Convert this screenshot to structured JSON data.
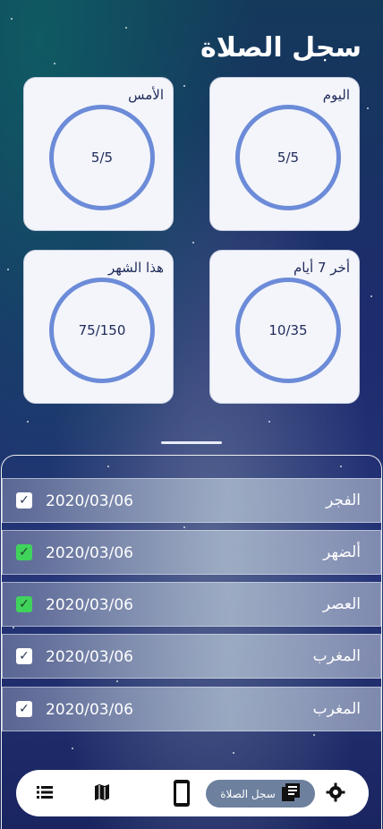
{
  "header": {
    "title": "سجل الصلاة"
  },
  "cards": [
    {
      "label": "اليوم",
      "value": "5/5"
    },
    {
      "label": "الأمس",
      "value": "5/5"
    },
    {
      "label": "أخر 7 أيام",
      "value": "10/35"
    },
    {
      "label": "هذا الشهر",
      "value": "75/150"
    }
  ],
  "prayers": [
    {
      "name": "الفجر",
      "date": "2020/03/06",
      "checked": true,
      "done": false
    },
    {
      "name": "ألضهر",
      "date": "2020/03/06",
      "checked": true,
      "done": true
    },
    {
      "name": "العصر",
      "date": "2020/03/06",
      "checked": true,
      "done": true
    },
    {
      "name": "المغرب",
      "date": "2020/03/06",
      "checked": true,
      "done": false
    },
    {
      "name": "المغرب",
      "date": "2020/03/06",
      "checked": true,
      "done": false
    }
  ],
  "navbar": {
    "active_label": "سجل الصلاة",
    "items": [
      "list-icon",
      "map-icon",
      "phone-icon",
      "prayer-log-icon",
      "settings-icon"
    ]
  }
}
